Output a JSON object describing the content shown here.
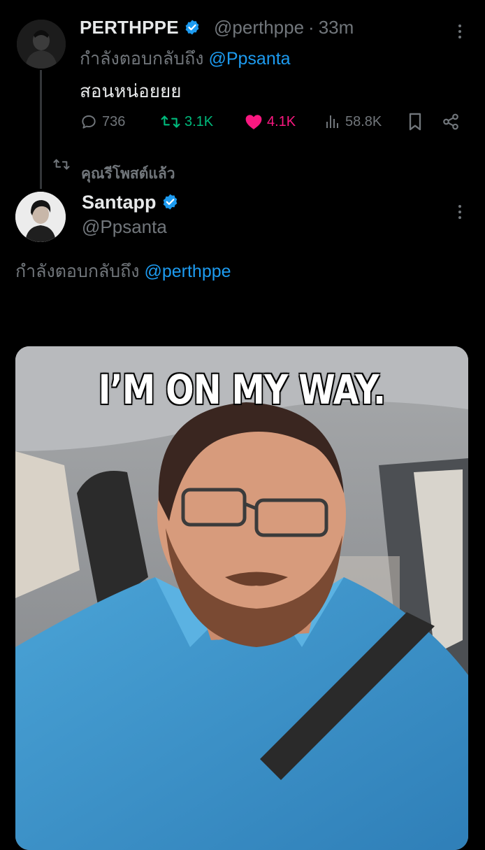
{
  "reply_post": {
    "display_name": "PERTHPPE",
    "handle": "@perthppe",
    "time": "33m",
    "reply_prefix": "กำลังตอบกลับถึง",
    "reply_to": "@Ppsanta",
    "text": "สอนหน่อยยย",
    "stats": {
      "replies": "736",
      "reposts": "3.1K",
      "likes": "4.1K",
      "views": "58.8K"
    }
  },
  "repost_label": "คุณรีโพสต์แล้ว",
  "main_post": {
    "display_name": "Santapp",
    "handle": "@Ppsanta",
    "reply_prefix": "กำลังตอบกลับถึง",
    "reply_to": "@perthppe",
    "media_caption": "I’M ON MY WAY."
  },
  "colors": {
    "background": "#000000",
    "text": "#e7e9ea",
    "muted": "#71767b",
    "accent": "#1d9bf0",
    "repost_active": "#00ba7c",
    "like_active": "#f91880"
  },
  "icons": {
    "reply": "speech-bubble-icon",
    "repost": "repost-arrows-icon",
    "like": "heart-icon",
    "views": "bar-chart-icon",
    "bookmark": "bookmark-icon",
    "share": "share-icon",
    "verified": "verified-badge-icon",
    "more": "more-dots-icon"
  }
}
